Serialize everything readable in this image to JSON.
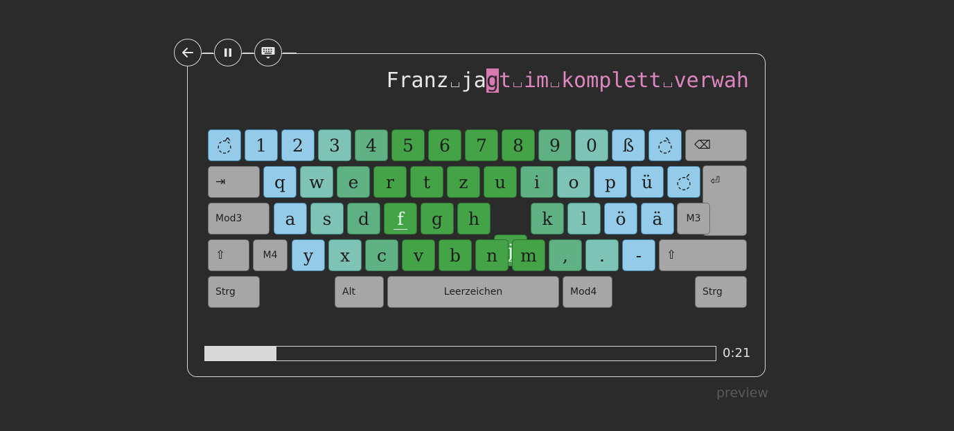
{
  "toolbar": {
    "back_icon": "arrow-left-icon",
    "pause_icon": "pause-icon",
    "keyboard_icon": "keyboard-icon"
  },
  "text": {
    "typed": [
      "Franz",
      "ja"
    ],
    "current": "g",
    "pending_first": "t",
    "pending_words": [
      "im",
      "komplett",
      "verwah"
    ]
  },
  "colors": {
    "cursor": "#d87ab1",
    "pending_text": "#dd86bf",
    "finger_blue": "#93cbe9",
    "finger_teal": "#7ec3b6",
    "finger_mid": "#5fb083",
    "finger_green": "#44a247",
    "modifier": "#a6a6a6"
  },
  "keyboard": {
    "row1": [
      "◌̂",
      "1",
      "2",
      "3",
      "4",
      "5",
      "6",
      "7",
      "8",
      "9",
      "0",
      "ß",
      "◌̀",
      "⌫"
    ],
    "row2": [
      "⇥",
      "q",
      "w",
      "e",
      "r",
      "t",
      "z",
      "u",
      "i",
      "o",
      "p",
      "ü",
      "◌́",
      "⏎"
    ],
    "row3": [
      "Mod3",
      "a",
      "s",
      "d",
      "f",
      "g",
      "h",
      "j",
      "k",
      "l",
      "ö",
      "ä",
      "M3"
    ],
    "row4": [
      "⇧",
      "M4",
      "y",
      "x",
      "c",
      "v",
      "b",
      "n",
      "m",
      ",",
      ".",
      "-",
      "⇧"
    ],
    "row5": [
      "Strg",
      "Alt",
      "Leerzeichen",
      "Mod4",
      "Strg"
    ]
  },
  "progress": {
    "value": 0.14,
    "time": "0:21"
  },
  "footer": {
    "label": "preview"
  }
}
